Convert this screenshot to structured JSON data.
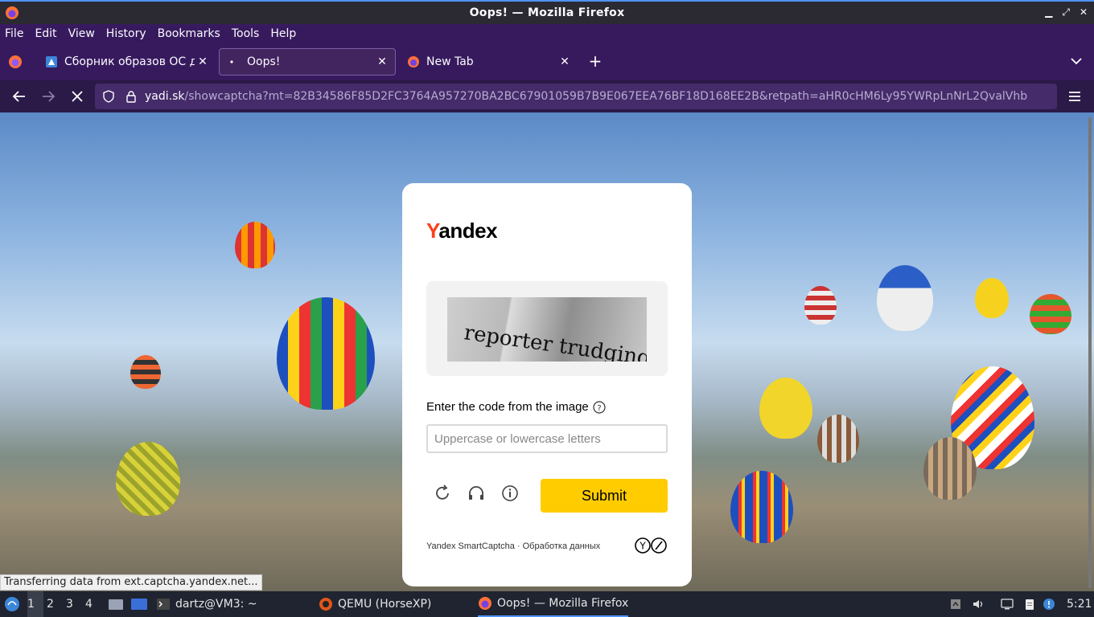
{
  "window": {
    "title": "Oops! — Mozilla Firefox"
  },
  "menu": [
    {
      "label": "File"
    },
    {
      "label": "Edit"
    },
    {
      "label": "View"
    },
    {
      "label": "History"
    },
    {
      "label": "Bookmarks"
    },
    {
      "label": "Tools"
    },
    {
      "label": "Help"
    }
  ],
  "tabs": [
    {
      "title": "Сборник образов ОС дл",
      "icon": "site-icon"
    },
    {
      "title": "Oops!",
      "icon": "loading-icon"
    },
    {
      "title": "New Tab",
      "icon": "firefox-icon"
    }
  ],
  "urlbar": {
    "domain": "yadi.sk",
    "path": "/showcaptcha?mt=82B34586F85D2FC3764A957270BA2BC67901059B7B9E067EEA76BF18D168EE2B&retpath=aHR0cHM6Ly95YWRpLnNrL2QvalVhb"
  },
  "captcha": {
    "logo_first": "Y",
    "logo_rest": "andex",
    "image_text": "reporter trudging",
    "label": "Enter the code from the image",
    "input_placeholder": "Uppercase or lowercase letters",
    "input_value": "",
    "submit_label": "Submit",
    "footer": "Yandex SmartCaptcha · Обработка данных",
    "submit_color": "#ffcc00"
  },
  "status_text": "Transferring data from ext.captcha.yandex.net...",
  "taskbar": {
    "workspaces": [
      "1",
      "2",
      "3",
      "4"
    ],
    "tasks": [
      {
        "label": "dartz@VM3: ~",
        "icon": "terminal-icon"
      },
      {
        "label": "QEMU (HorseXP)",
        "icon": "qemu-icon"
      },
      {
        "label": "Oops! — Mozilla Firefox",
        "icon": "firefox-icon"
      }
    ],
    "clock": "5:21"
  }
}
